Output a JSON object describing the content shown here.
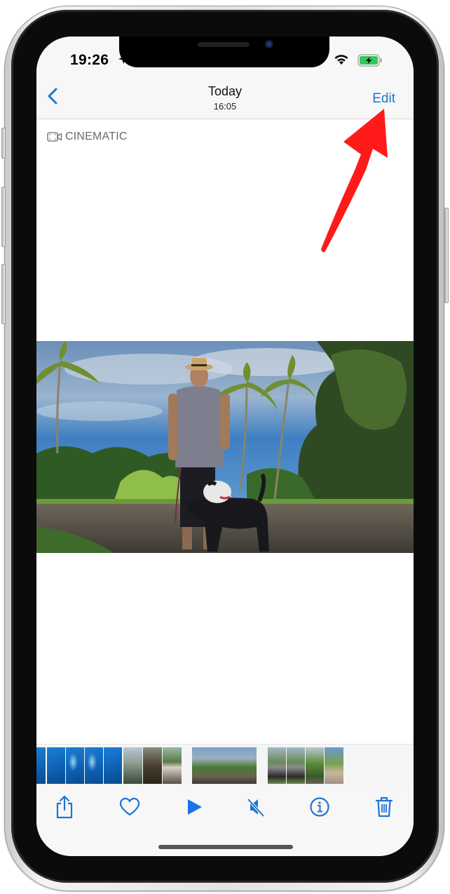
{
  "status_bar": {
    "time": "19:26",
    "location_icon": "location-arrow-icon",
    "wifi_icon": "wifi-icon",
    "battery_icon": "battery-charging-icon",
    "battery_color": "#34c759"
  },
  "nav": {
    "back_icon": "chevron-left-icon",
    "title": "Today",
    "subtitle": "16:05",
    "edit_label": "Edit",
    "accent_color": "#1e74d6"
  },
  "content": {
    "badge_icon": "cinematic-video-icon",
    "badge_label": "CINEMATIC",
    "photo_description": "Man in straw hat and grey short-sleeve shirt standing with a black and white dog on a leash, palm trees and blue sky in background"
  },
  "filmstrip": {
    "thumbnails": [
      {
        "kind": "blue-underwater"
      },
      {
        "kind": "blue-underwater"
      },
      {
        "kind": "blue-underwater"
      },
      {
        "kind": "blue-underwater"
      },
      {
        "kind": "blue-underwater"
      },
      {
        "kind": "outdoor-building"
      },
      {
        "kind": "outdoor-shade"
      },
      {
        "kind": "man-with-dog"
      },
      {
        "kind": "man-with-dog-wide",
        "selected": true
      },
      {
        "kind": "man-standing"
      },
      {
        "kind": "man-standing"
      },
      {
        "kind": "palm-trees"
      },
      {
        "kind": "person-walking"
      }
    ]
  },
  "toolbar": {
    "items": [
      {
        "name": "share",
        "icon": "share-icon"
      },
      {
        "name": "favorite",
        "icon": "heart-icon"
      },
      {
        "name": "play",
        "icon": "play-icon"
      },
      {
        "name": "mute",
        "icon": "speaker-muted-icon"
      },
      {
        "name": "info",
        "icon": "info-icon"
      },
      {
        "name": "delete",
        "icon": "trash-icon"
      }
    ]
  },
  "annotation": {
    "arrow_color": "#ff1a1a",
    "points_to": "Edit"
  }
}
